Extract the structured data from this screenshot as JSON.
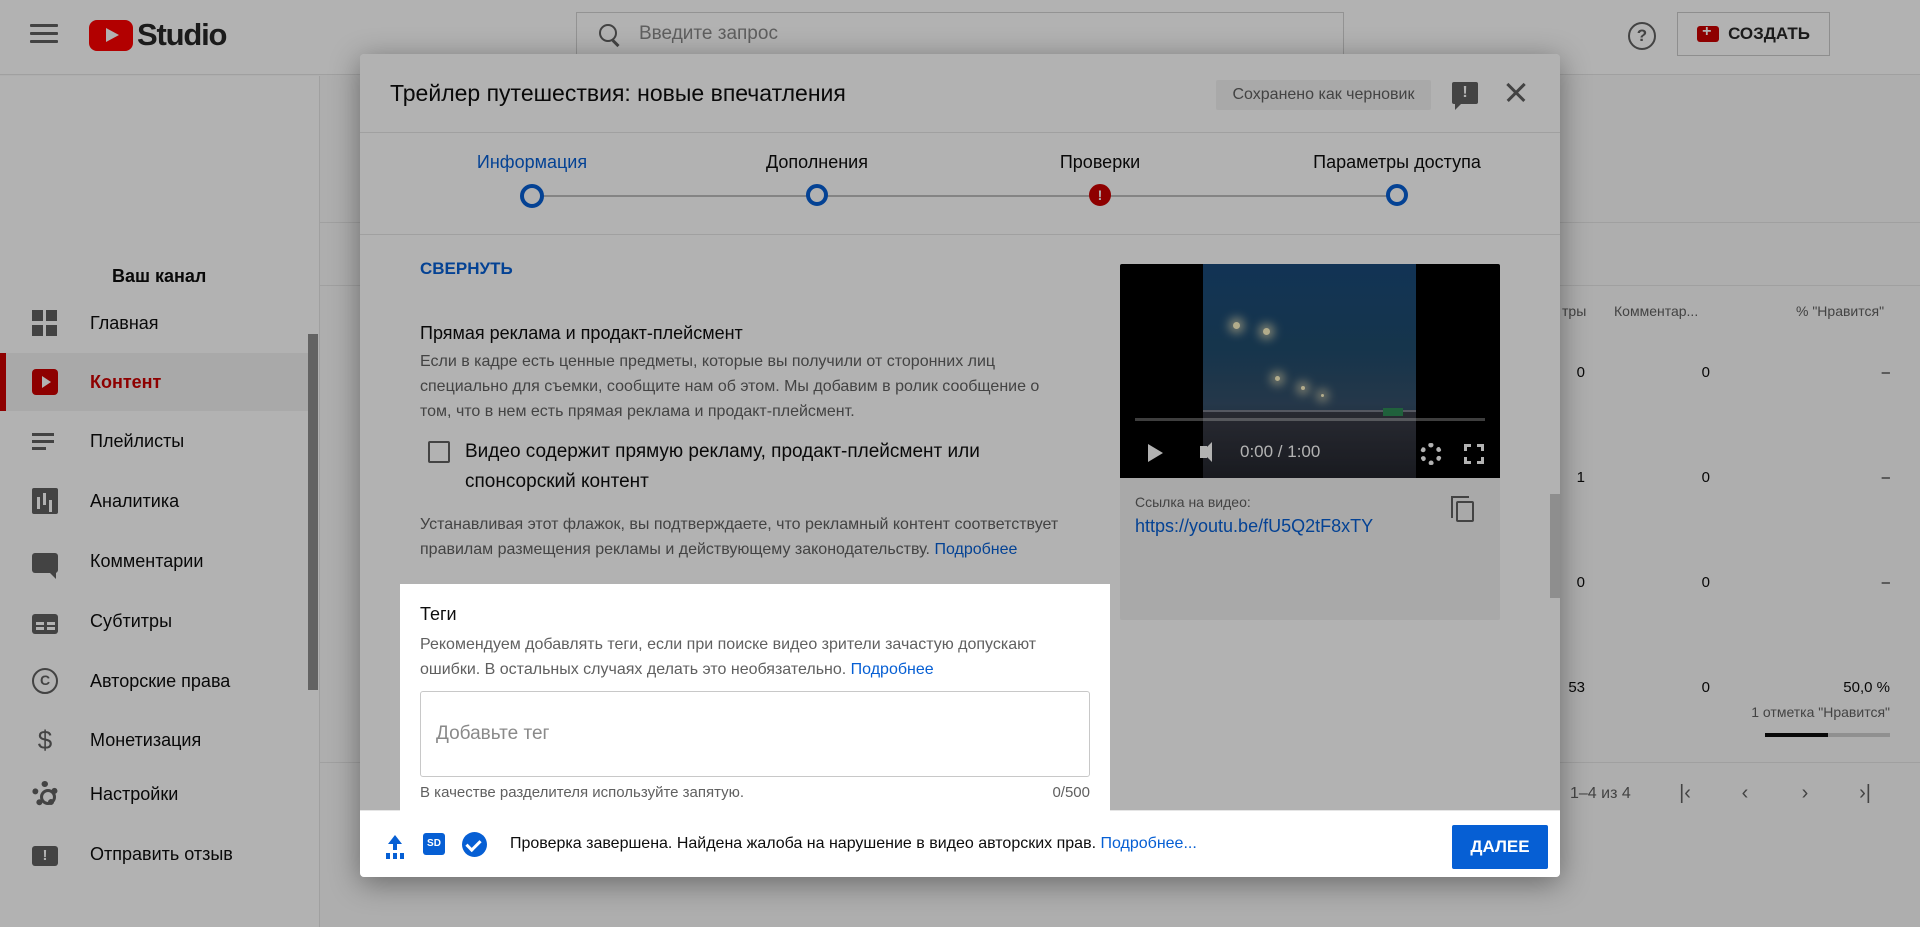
{
  "app": {
    "logo_text": "Studio",
    "search_placeholder": "Введите запрос",
    "help_glyph": "?",
    "create_label": "СОЗДАТЬ"
  },
  "sidebar": {
    "channel_label": "Ваш канал",
    "items": [
      {
        "label": "Главная",
        "icon": "dashboard-icon"
      },
      {
        "label": "Контент",
        "icon": "content-icon",
        "active": true
      },
      {
        "label": "Плейлисты",
        "icon": "playlist-icon"
      },
      {
        "label": "Аналитика",
        "icon": "analytics-icon"
      },
      {
        "label": "Комментарии",
        "icon": "comments-icon"
      },
      {
        "label": "Субтитры",
        "icon": "subtitles-icon"
      },
      {
        "label": "Авторские права",
        "icon": "copyright-icon"
      },
      {
        "label": "Монетизация",
        "icon": "dollar-icon"
      },
      {
        "label": "Настройки",
        "icon": "gear-icon"
      },
      {
        "label": "Отправить отзыв",
        "icon": "feedback-icon"
      }
    ]
  },
  "table": {
    "headers": [
      "тры",
      "Комментар...",
      "% \"Нравится\""
    ],
    "rows": [
      {
        "views": "0",
        "comments": "0",
        "likes": "–"
      },
      {
        "views": "1",
        "comments": "0",
        "likes": "–"
      },
      {
        "views": "0",
        "comments": "0",
        "likes": "–"
      },
      {
        "views": "53",
        "comments": "0",
        "likes": "50,0 %",
        "likes_sub": "1 отметка \"Нравится\"",
        "likes_ratio": 0.5
      }
    ],
    "pagination": "1–4 из 4"
  },
  "dialog": {
    "title": "Трейлер путешествия: новые впечатления",
    "draft_badge": "Сохранено как черновик",
    "steps": [
      {
        "label": "Информация",
        "state": "active"
      },
      {
        "label": "Дополнения",
        "state": "done"
      },
      {
        "label": "Проверки",
        "state": "error"
      },
      {
        "label": "Параметры доступа",
        "state": "done"
      }
    ],
    "collapse_link": "СВЕРНУТЬ",
    "paid_promotion": {
      "title": "Прямая реклама и продакт-плейсмент",
      "desc_line1": "Если в кадре есть ценные предметы, которые вы получили от сторонних лиц",
      "desc_line2": "специально для съемки, сообщите нам об этом. Мы добавим в ролик сообщение о",
      "desc_line3": "том, что в нем есть прямая реклама и продакт-плейсмент.",
      "checkbox_label_line1": "Видео содержит прямую рекламу, продакт-плейсмент или",
      "checkbox_label_line2": "спонсорский контент",
      "checkbox_checked": false,
      "disclaimer_line1": "Устанавливая этот флажок, вы подтверждаете, что рекламный контент соответствует",
      "disclaimer_line2": "правилам размещения рекламы и действующему законодательству.",
      "learn_more": "Подробнее"
    },
    "tags": {
      "title": "Теги",
      "desc_line1": "Рекомендуем добавлять теги, если при поиске видео зрители зачастую допускают",
      "desc_line2": "ошибки. В остальных случаях делать это необязательно.",
      "learn_more": "Подробнее",
      "placeholder": "Добавьте тег",
      "value": "",
      "hint": "В качестве разделителя используйте запятую.",
      "counter": "0/500"
    },
    "video": {
      "time": "0:00 / 1:00",
      "progress": 0.0,
      "link_label": "Ссылка на видео:",
      "url": "https://youtu.be/fU5Q2tF8xTY"
    },
    "footer": {
      "status_text": "Проверка завершена. Найдена жалоба на нарушение в видео авторских прав.",
      "learn_more": "Подробнее...",
      "sd_badge": "SD",
      "next_label": "ДАЛЕЕ"
    }
  },
  "colors": {
    "accent_blue": "#065fd4",
    "brand_red": "#cc0000",
    "logo_red": "#ff0000",
    "text_secondary": "#606060"
  }
}
